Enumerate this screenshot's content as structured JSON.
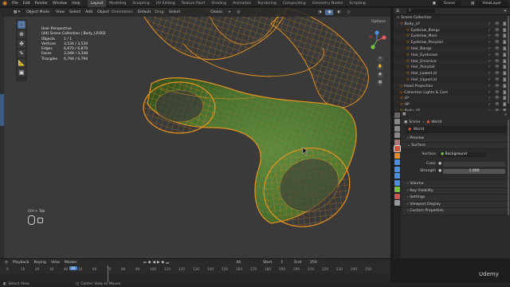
{
  "menus": [
    "File",
    "Edit",
    "Render",
    "Window",
    "Help"
  ],
  "workspaces": [
    "Layout",
    "Modeling",
    "Sculpting",
    "UV Editing",
    "Texture Paint",
    "Shading",
    "Animation",
    "Rendering",
    "Compositing",
    "Geometry Nodes",
    "Scripting"
  ],
  "active_workspace": "Layout",
  "scene": {
    "label": "Scene"
  },
  "view_layer": {
    "label": "ViewLayer"
  },
  "viewport_header": {
    "mode": "Object Mode",
    "menus": [
      "View",
      "Select",
      "Add",
      "Object"
    ],
    "orientation_label": "Orientation:",
    "orientation": "Default",
    "drag_label": "Drag:",
    "drag": "Select",
    "transform": "Global",
    "options": "Options"
  },
  "overlay": {
    "title": "User Perspective",
    "collection": "(44) Scene Collection | Body_LP.002",
    "stats": [
      {
        "k": "Objects",
        "v": "1 / 1"
      },
      {
        "k": "Vertices",
        "v": "3,534 / 3,534"
      },
      {
        "k": "Edges",
        "v": "6,870 / 6,870"
      },
      {
        "k": "Faces",
        "v": "3,348 / 3,348"
      },
      {
        "k": "Triangles",
        "v": "6,794 / 6,794"
      }
    ]
  },
  "hint": {
    "label": "Ctrl + Tab"
  },
  "outliner": {
    "root": "Scene Collection",
    "items": [
      "Body_LP",
      "Eyebrow_Bangs",
      "Eyebrow_Main",
      "Eyebrow_Ponytail",
      "Hair_Bangs",
      "Hair_Eyebrows",
      "Hair_Emissive",
      "Hair_Ponytail",
      "Hair_LowerLid",
      "Hair_UpperLid",
      "Head Projection",
      "Collection Lights & Cam",
      "LP",
      "HP",
      "Body_LP"
    ]
  },
  "properties": {
    "breadcrumb": [
      "Scene",
      "World"
    ],
    "world_name": "World",
    "panels": [
      "Preview",
      "Surface"
    ],
    "surface": {
      "label": "Surface",
      "value": "Background"
    },
    "color": {
      "label": "Color"
    },
    "strength": {
      "label": "Strength",
      "value": "1.000"
    },
    "sub_panels": [
      "Volume",
      "Ray Visibility",
      "Settings",
      "Viewport Display",
      "Custom Properties"
    ]
  },
  "timeline": {
    "menus": [
      "Playback",
      "Keying",
      "View",
      "Marker"
    ],
    "current_frame": "44",
    "start_label": "Start",
    "start": "1",
    "end_label": "End",
    "end": "250",
    "ticks": [
      "0",
      "10",
      "20",
      "30",
      "40",
      "44",
      "50",
      "60",
      "70",
      "80",
      "90",
      "100",
      "110",
      "120",
      "130",
      "140",
      "150",
      "160",
      "170",
      "180",
      "190",
      "200",
      "210",
      "220",
      "230",
      "240",
      "250"
    ]
  },
  "status": {
    "left": "Select View",
    "center": "Center View to Mouse",
    "right": "Udemy"
  },
  "colors": {
    "selected": "#e8941f",
    "mesh": "#4e7a34",
    "accent": "#4d6e9a"
  }
}
